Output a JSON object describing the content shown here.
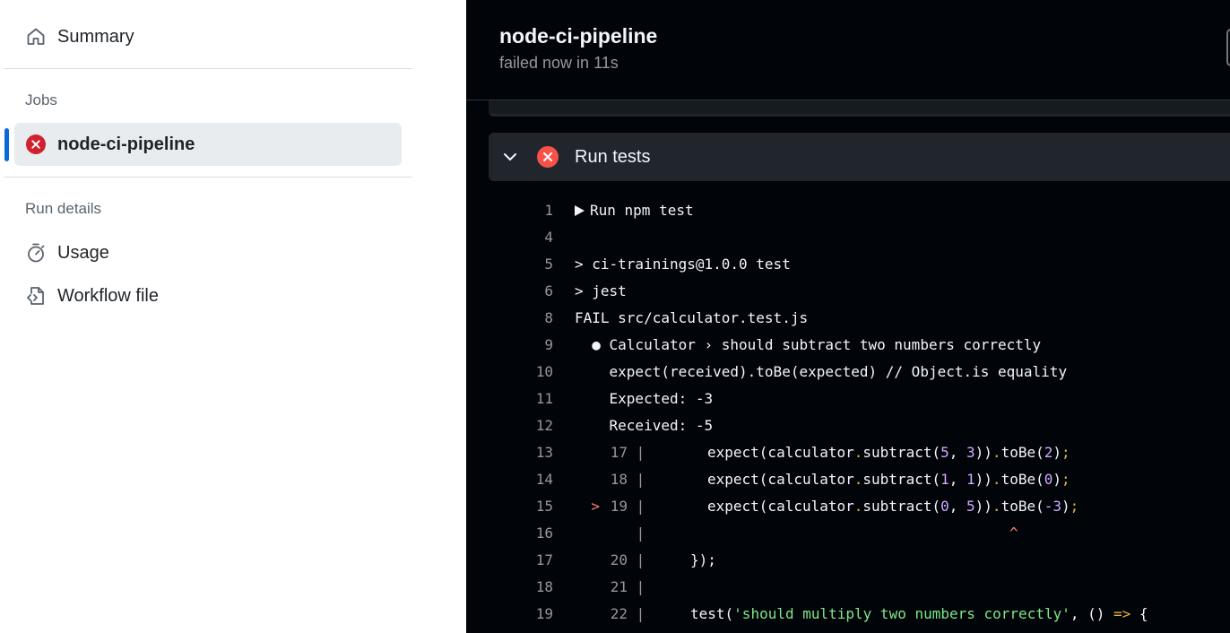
{
  "sidebar": {
    "summary_label": "Summary",
    "jobs_heading": "Jobs",
    "job_name": "node-ci-pipeline",
    "run_details_heading": "Run details",
    "usage_label": "Usage",
    "workflow_file_label": "Workflow file"
  },
  "header": {
    "title": "node-ci-pipeline",
    "subtitle": "failed now in 11s"
  },
  "step": {
    "label": "Run tests",
    "status": "failed"
  },
  "log": {
    "lines": [
      {
        "n": "1",
        "text": "Run npm test"
      },
      {
        "n": "4",
        "text": ""
      },
      {
        "n": "5",
        "text": "> ci-trainings@1.0.0 test"
      },
      {
        "n": "6",
        "text": "> jest"
      },
      {
        "n": "8",
        "text": "FAIL src/calculator.test.js"
      },
      {
        "n": "9",
        "text": "  ● Calculator › should subtract two numbers correctly"
      },
      {
        "n": "10",
        "text": "    expect(received).toBe(expected) // Object.is equality"
      },
      {
        "n": "11",
        "text": "    Expected: -3"
      },
      {
        "n": "12",
        "text": "    Received: -5"
      },
      {
        "n": "13",
        "gutter": "17",
        "code": [
          "expect(calculator",
          ".",
          "subtract(",
          "5",
          ", ",
          "3",
          "))",
          ".",
          "toBe(",
          "2",
          ")",
          ";"
        ]
      },
      {
        "n": "14",
        "gutter": "18",
        "code": [
          "expect(calculator",
          ".",
          "subtract(",
          "1",
          ", ",
          "1",
          "))",
          ".",
          "toBe(",
          "0",
          ")",
          ";"
        ]
      },
      {
        "n": "15",
        "gutter": "19",
        "marker": ">",
        "code": [
          "expect(calculator",
          ".",
          "subtract(",
          "0",
          ", ",
          "5",
          "))",
          ".",
          "toBe(",
          "-3",
          ")",
          ";"
        ]
      },
      {
        "n": "16",
        "caret": "^"
      },
      {
        "n": "17",
        "gutter": "20",
        "code": [
          "});"
        ]
      },
      {
        "n": "18",
        "gutter": "21",
        "code": [
          ""
        ]
      },
      {
        "n": "19",
        "gutter": "22",
        "code": [
          "test(",
          "'should multiply two numbers correctly'",
          ", () ",
          "=>",
          " {"
        ]
      }
    ]
  },
  "colors": {
    "accent": "#0969da",
    "fail": "#cf222e",
    "fail_dark": "#f85149",
    "log_bg": "#010409"
  },
  "icons": [
    "home-icon",
    "x-circle-fill-icon",
    "stopwatch-icon",
    "file-code-icon",
    "chevron-down-icon",
    "triangle-right-icon"
  ]
}
